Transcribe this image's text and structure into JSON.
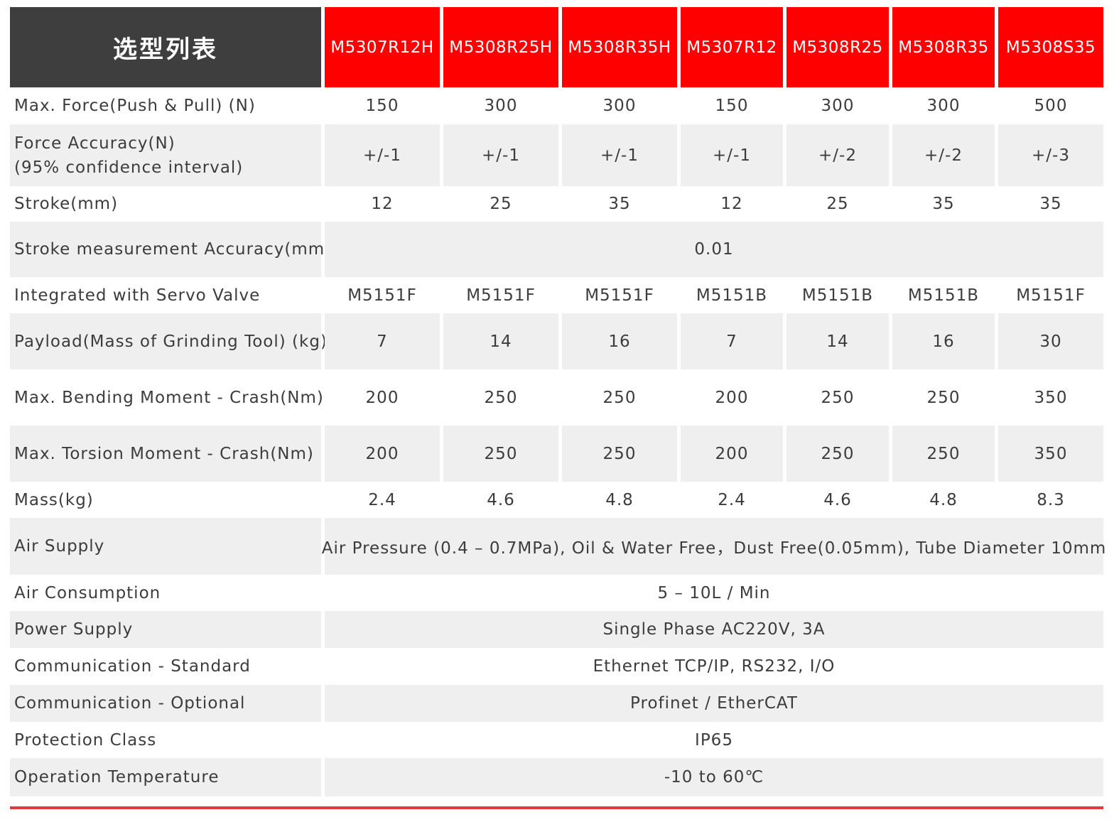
{
  "header": {
    "title": "选型列表",
    "models": [
      "M5307R12H",
      "M5308R25H",
      "M5308R35H",
      "M5307R12",
      "M5308R25",
      "M5308R35",
      "M5308S35"
    ]
  },
  "rows": {
    "max_force": {
      "label": "Max. Force(Push & Pull) (N)",
      "values": [
        "150",
        "300",
        "300",
        "150",
        "300",
        "300",
        "500"
      ]
    },
    "force_accuracy": {
      "label_line1": "Force Accuracy(N)",
      "label_line2": "(95% confidence interval)",
      "values": [
        "+/-1",
        "+/-1",
        "+/-1",
        "+/-1",
        "+/-2",
        "+/-2",
        "+/-3"
      ]
    },
    "stroke": {
      "label": "Stroke(mm)",
      "values": [
        "12",
        "25",
        "35",
        "12",
        "25",
        "35",
        "35"
      ]
    },
    "stroke_accuracy": {
      "label": "Stroke measurement Accuracy(mm)",
      "value": "0.01"
    },
    "servo_valve": {
      "label": "Integrated with Servo Valve",
      "values": [
        "M5151F",
        "M5151F",
        "M5151F",
        "M5151B",
        "M5151B",
        "M5151B",
        "M5151F"
      ]
    },
    "payload": {
      "label": "Payload(Mass of Grinding Tool) (kg)",
      "values": [
        "7",
        "14",
        "16",
        "7",
        "14",
        "16",
        "30"
      ]
    },
    "bending": {
      "label": "Max. Bending Moment - Crash(Nm)",
      "values": [
        "200",
        "250",
        "250",
        "200",
        "250",
        "250",
        "350"
      ]
    },
    "torsion": {
      "label": "Max. Torsion Moment - Crash(Nm)",
      "values": [
        "200",
        "250",
        "250",
        "200",
        "250",
        "250",
        "350"
      ]
    },
    "mass": {
      "label": "Mass(kg)",
      "values": [
        "2.4",
        "4.6",
        "4.8",
        "2.4",
        "4.6",
        "4.8",
        "8.3"
      ]
    },
    "air_supply": {
      "label": "Air Supply",
      "value": "Air Pressure (0.4 – 0.7MPa), Oil & Water Free，Dust Free(0.05mm), Tube Diameter 10mm"
    },
    "air_consumption": {
      "label": "Air Consumption",
      "value": "5 – 10L / Min"
    },
    "power_supply": {
      "label": "Power Supply",
      "value": "Single Phase AC220V, 3A"
    },
    "comm_standard": {
      "label": "Communication - Standard",
      "value": "Ethernet TCP/IP, RS232, I/O"
    },
    "comm_optional": {
      "label": "Communication - Optional",
      "value": "Profinet / EtherCAT"
    },
    "protection": {
      "label": "Protection Class",
      "value": "IP65"
    },
    "temperature": {
      "label": "Operation Temperature",
      "value": "-10 to 60℃"
    }
  },
  "colors": {
    "header_dark": "#3e3e3e",
    "header_red": "#ff0000",
    "row_gray": "#efefef",
    "bottom_line": "#e03a3a"
  }
}
